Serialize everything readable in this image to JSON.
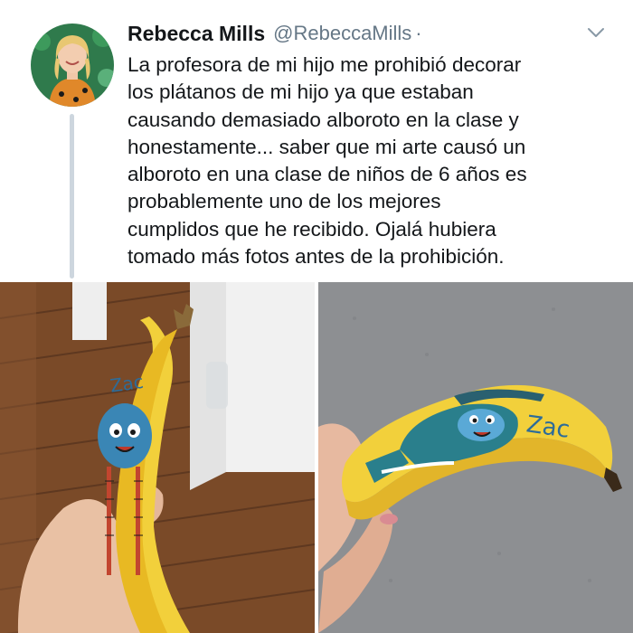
{
  "tweet": {
    "display_name": "Rebecca Mills",
    "handle": "@RebeccaMills",
    "separator": "·",
    "text_lines": [
      "La profesora de mi hijo me prohibió decorar",
      "los plátanos de mi hijo ya que estaban",
      "causando demasiado alboroto en la clase y",
      "honestamente... saber que mi arte causó un",
      "alboroto en una clase de niños de 6 años es",
      "probablemente uno de los mejores",
      "cumplidos que he recibido. Ojalá hubiera",
      "tomado más fotos antes de la prohibición."
    ]
  },
  "photos": {
    "left_banana_label": "Zac",
    "right_banana_label": "Zac"
  },
  "icons": {
    "caret": "chevron-down-icon",
    "avatar": "avatar"
  },
  "colors": {
    "text": "#14171a",
    "muted": "#657786",
    "thread_line": "#cdd6de",
    "banana": "#f2d03b",
    "banana_ink": "#3a86b5"
  }
}
